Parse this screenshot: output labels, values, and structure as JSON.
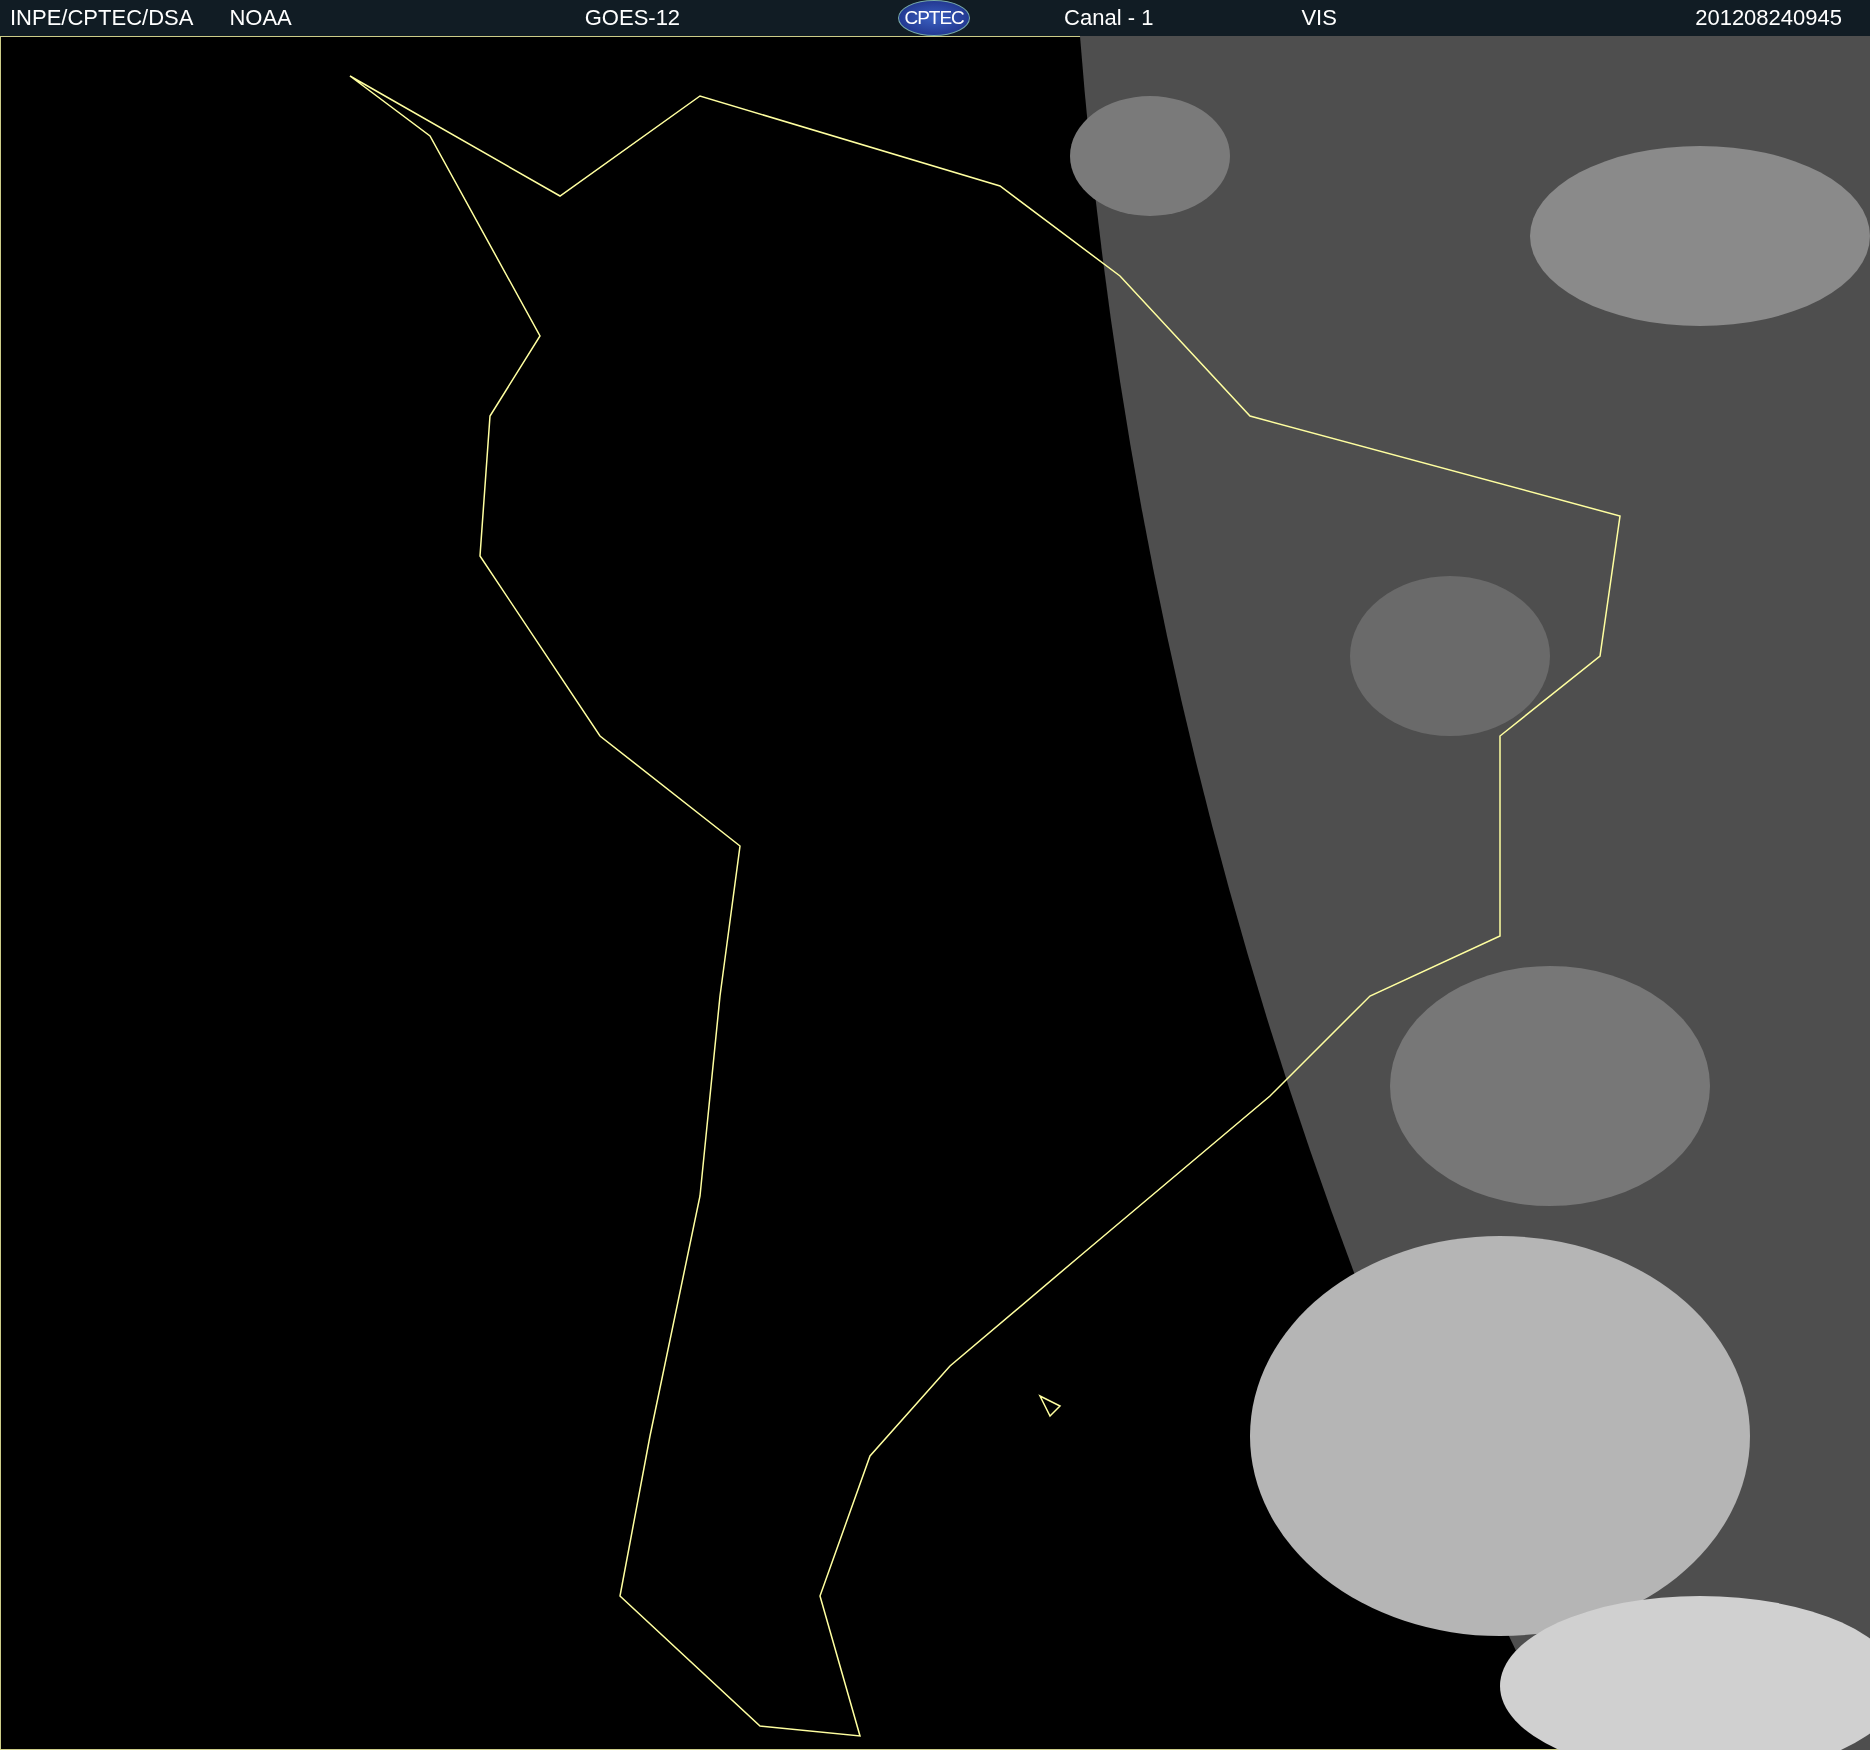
{
  "header": {
    "institution": "INPE/CPTEC/DSA",
    "agency": "NOAA",
    "satellite": "GOES-12",
    "logo": "CPTEC",
    "channel": "Canal - 1",
    "band": "VIS",
    "timestamp": "201208240945"
  }
}
